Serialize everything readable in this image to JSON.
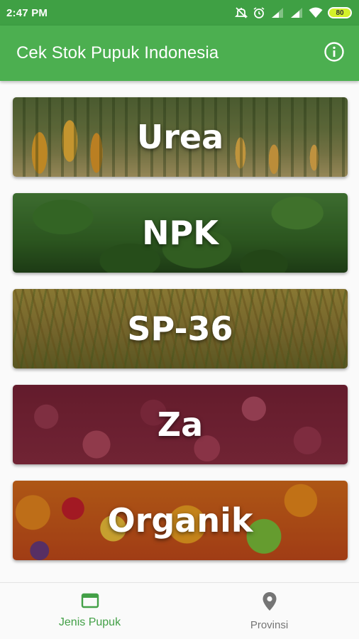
{
  "status_bar": {
    "time": "2:47 PM",
    "battery": "80",
    "icons": [
      "mute-icon",
      "alarm-icon",
      "signal-icon",
      "signal-icon",
      "wifi-icon",
      "battery-icon"
    ]
  },
  "app_bar": {
    "title": "Cek Stok Pupuk Indonesia",
    "action_icon": "info-icon"
  },
  "cards": [
    {
      "label": "Urea",
      "image": "corn-field"
    },
    {
      "label": "NPK",
      "image": "green-leaves"
    },
    {
      "label": "SP-36",
      "image": "rice-paddy"
    },
    {
      "label": "Za",
      "image": "shallots"
    },
    {
      "label": "Organik",
      "image": "fruits"
    }
  ],
  "bottom_nav": {
    "items": [
      {
        "label": "Jenis Pupuk",
        "icon": "window-icon",
        "active": true
      },
      {
        "label": "Provinsi",
        "icon": "location-pin-icon",
        "active": false
      }
    ]
  },
  "colors": {
    "status_bar": "#3fa044",
    "app_bar": "#4caf50",
    "nav_active": "#43a047",
    "nav_inactive": "#757575"
  }
}
